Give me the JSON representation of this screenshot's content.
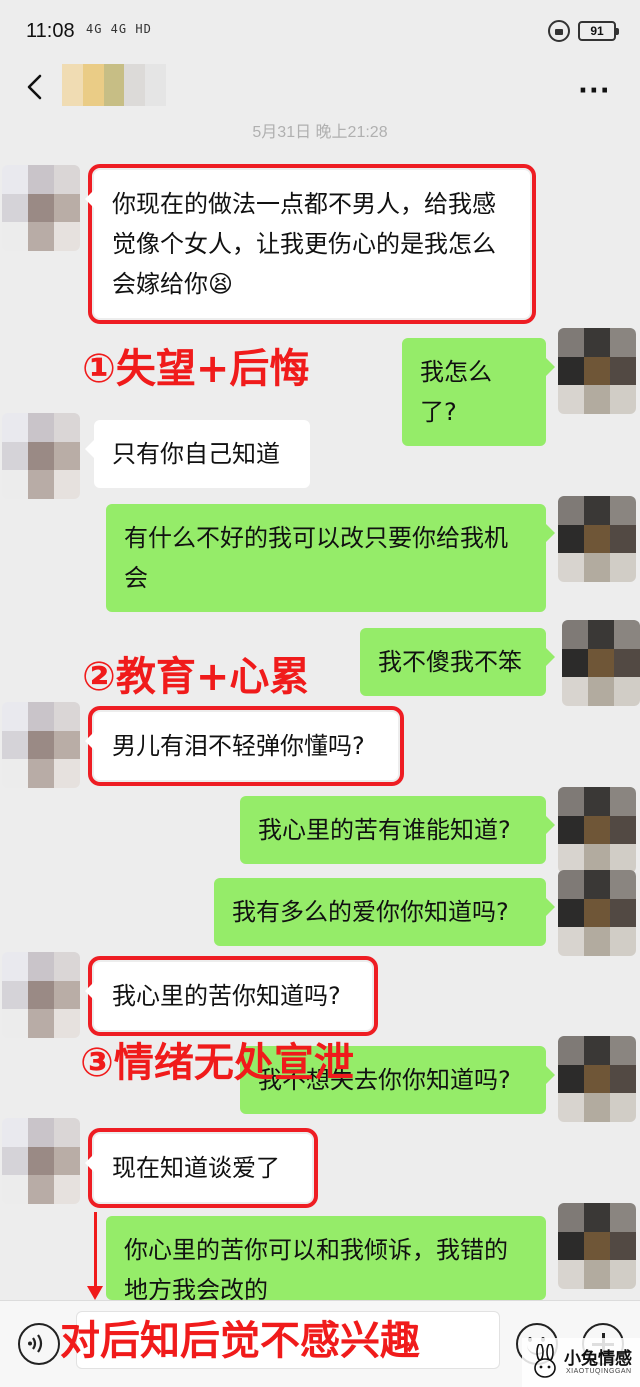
{
  "status_bar": {
    "time": "11:08",
    "network": "4G  4G  HD",
    "battery": "91"
  },
  "header": {
    "back_icon": "back-chevron-icon",
    "more_icon": "more-dots-icon",
    "more_label": "···"
  },
  "timestamp": "5月31日 晚上21:28",
  "messages": [
    {
      "side": "left",
      "text": "你现在的做法一点都不男人，给我感觉像个女人，让我更伤心的是我怎么会嫁给你😫"
    },
    {
      "side": "right",
      "text": "我怎么了?"
    },
    {
      "side": "left",
      "text": "只有你自己知道"
    },
    {
      "side": "right",
      "text": "有什么不好的我可以改只要你给我机会"
    },
    {
      "side": "right",
      "text": "我不傻我不笨"
    },
    {
      "side": "left",
      "text": "男儿有泪不轻弹你懂吗?"
    },
    {
      "side": "right",
      "text": "我心里的苦有谁能知道?"
    },
    {
      "side": "right",
      "text": "我有多么的爱你你知道吗?"
    },
    {
      "side": "left",
      "text": "我心里的苦你知道吗?"
    },
    {
      "side": "right",
      "text": "我不想失去你你知道吗?"
    },
    {
      "side": "left",
      "text": "现在知道谈爱了"
    },
    {
      "side": "right",
      "text": "你心里的苦你可以和我倾诉，我错的地方我会改的"
    }
  ],
  "annotations": [
    "①失望+后悔",
    "②教育+心累",
    "③情绪无处宣泄",
    "对后知后觉不感兴趣"
  ],
  "annotation_color": "#f01b1b",
  "input_bar": {
    "voice_icon": "voice-icon",
    "emoji_icon": "emoji-icon",
    "plus_icon": "plus-icon"
  },
  "watermark": {
    "title": "小兔情感",
    "subtitle": "XIAOTUQINGGAN"
  },
  "colors": {
    "background": "#ededed",
    "bubble_self": "#95ec69",
    "bubble_other": "#ffffff",
    "highlight_box": "#ee1d23"
  }
}
